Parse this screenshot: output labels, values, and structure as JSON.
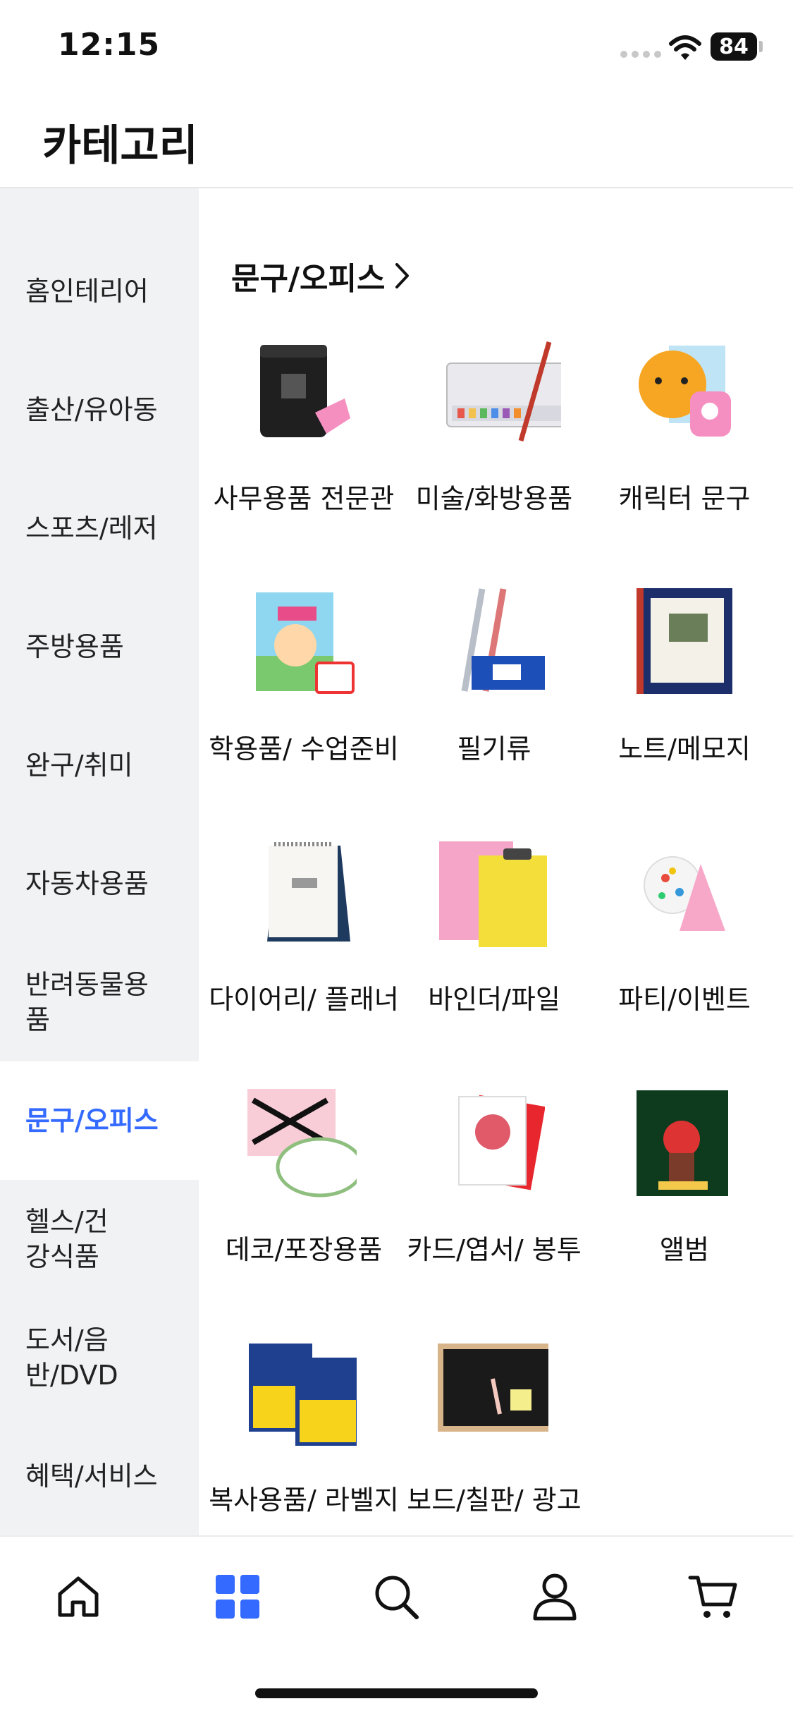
{
  "status": {
    "time": "12:15",
    "battery": "84"
  },
  "header": {
    "title": "카테고리"
  },
  "sidebar": {
    "items": [
      {
        "label": "홈인테리어"
      },
      {
        "label": "출산/유아동"
      },
      {
        "label": "스포츠/레저"
      },
      {
        "label": "주방용품"
      },
      {
        "label": "완구/취미"
      },
      {
        "label": "자동차용품"
      },
      {
        "label": "반려동물용품"
      },
      {
        "label": "문구/오피스"
      },
      {
        "label": "헬스/건강식품"
      },
      {
        "label": "도서/음반/DVD"
      },
      {
        "label": "혜택/서비스"
      }
    ],
    "active_index": 7
  },
  "main": {
    "section_title": "문구/오피스",
    "categories": [
      {
        "label": "사무용품 전문관",
        "icon": "shredder-icon"
      },
      {
        "label": "미술/화방용품",
        "icon": "paint-set-icon"
      },
      {
        "label": "캐릭터 문구",
        "icon": "character-stationery-icon"
      },
      {
        "label": "학용품/ 수업준비",
        "icon": "school-supplies-icon"
      },
      {
        "label": "필기류",
        "icon": "pens-icon"
      },
      {
        "label": "노트/메모지",
        "icon": "notebook-icon"
      },
      {
        "label": "다이어리/ 플래너",
        "icon": "desk-calendar-icon"
      },
      {
        "label": "바인더/파일",
        "icon": "binder-icon"
      },
      {
        "label": "파티/이벤트",
        "icon": "party-hat-icon"
      },
      {
        "label": "데코/포장용품",
        "icon": "gift-wrap-icon"
      },
      {
        "label": "카드/엽서/ 봉투",
        "icon": "greeting-card-icon"
      },
      {
        "label": "앨범",
        "icon": "photo-album-icon"
      },
      {
        "label": "복사용품/ 라벨지",
        "icon": "copy-paper-icon"
      },
      {
        "label": "보드/칠판/ 광고",
        "icon": "chalkboard-icon"
      }
    ]
  },
  "bottom_nav": {
    "items": [
      "home-icon",
      "category-grid-icon",
      "search-icon",
      "profile-icon",
      "cart-icon"
    ],
    "active_index": 1,
    "active_color": "#346aff"
  },
  "colors": {
    "accent": "#346aff",
    "sidebar_bg": "#f1f2f4"
  }
}
